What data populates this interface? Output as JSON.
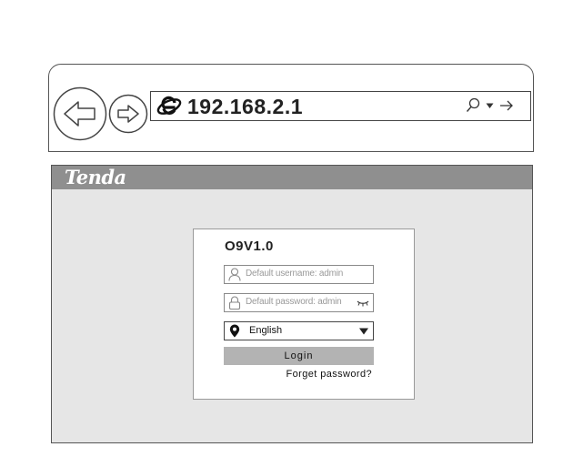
{
  "browser": {
    "url": "192.168.2.1",
    "icons": [
      "back-arrow-icon",
      "forward-arrow-icon",
      "ie-logo-icon",
      "search-icon",
      "dropdown-arrow-icon",
      "go-arrow-icon"
    ]
  },
  "page": {
    "logo": "Tenda",
    "model": "O9V1.0",
    "username_placeholder": "Default username: admin",
    "password_placeholder": "Default password: admin",
    "language": "English",
    "login_label": "Login",
    "forget_label": "Forget password?"
  },
  "colors": {
    "header_bar": "#8f8f8f",
    "page_background": "#e6e6e6",
    "login_button": "#b3b3b3"
  }
}
